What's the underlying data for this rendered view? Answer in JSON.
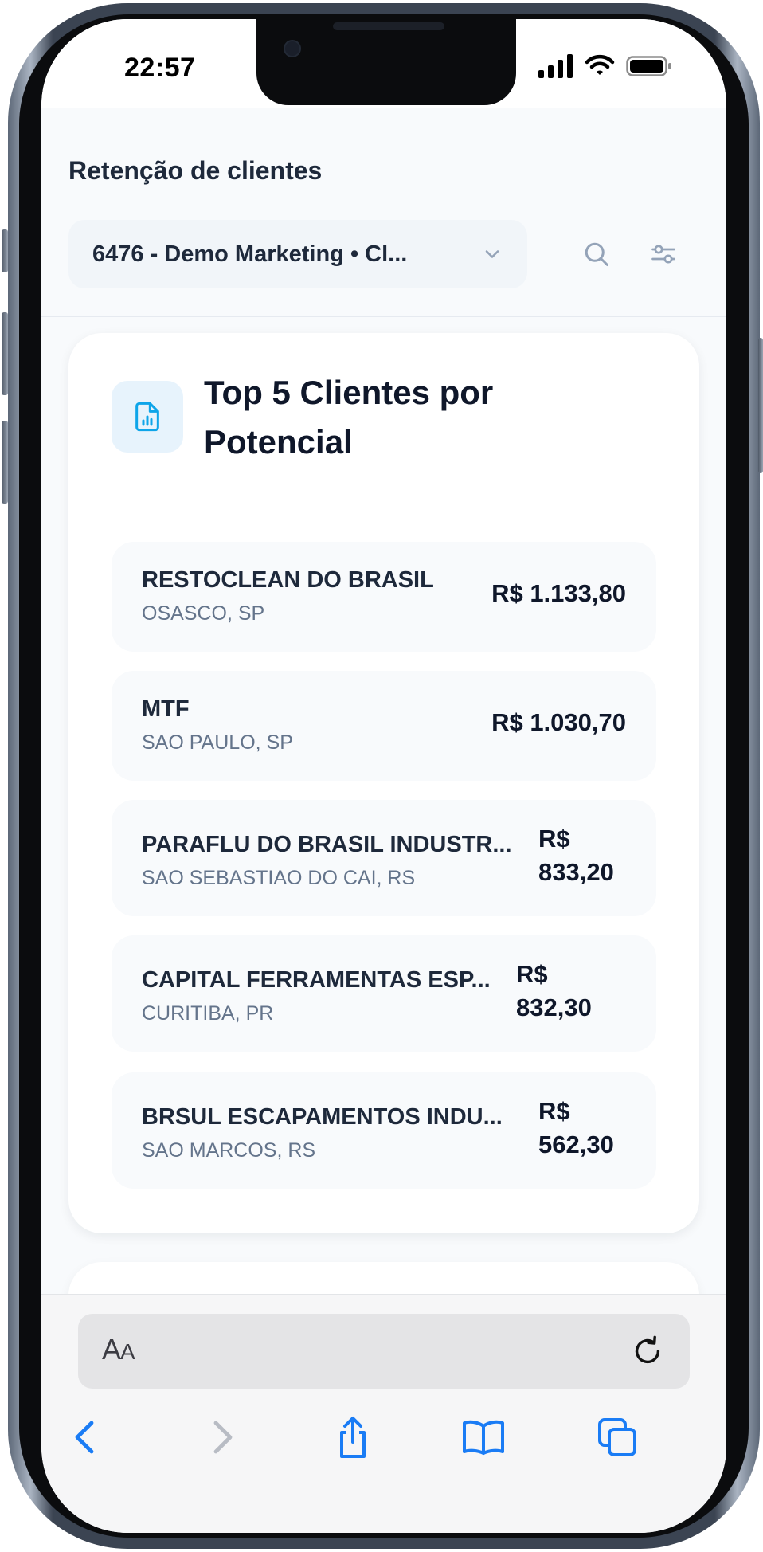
{
  "status_bar": {
    "time": "22:57"
  },
  "header": {
    "title": "Retenção de clientes",
    "client_selector": "6476 - Demo Marketing • Cl..."
  },
  "top_clients": {
    "title_line1": "Top 5 Clientes por",
    "title_line2": "Potencial",
    "rows": [
      {
        "name": "RESTOCLEAN DO BRASIL",
        "city": "OSASCO, SP",
        "value": "R$ 1.133,80"
      },
      {
        "name": "MTF",
        "city": "SAO PAULO, SP",
        "value": "R$ 1.030,70"
      },
      {
        "name": "PARAFLU DO BRASIL INDUSTR...",
        "city": "SAO SEBASTIAO DO CAI, RS",
        "value_currency": "R$",
        "value_amount": "833,20"
      },
      {
        "name": "CAPITAL FERRAMENTAS ESP...",
        "city": "CURITIBA, PR",
        "value_currency": "R$",
        "value_amount": "832,30"
      },
      {
        "name": "BRSUL ESCAPAMENTOS INDU...",
        "city": "SAO MARCOS, RS",
        "value_currency": "R$",
        "value_amount": "562,30"
      }
    ]
  },
  "browser": {
    "aa_large": "A",
    "aa_small": "A"
  },
  "colors": {
    "accent_icon": "#0ea5e9",
    "ios_blue": "#1a7cf5"
  },
  "icons": {
    "card": "file-chart-icon",
    "search": "search-icon",
    "filters": "sliders-icon",
    "reload": "reload-icon"
  }
}
